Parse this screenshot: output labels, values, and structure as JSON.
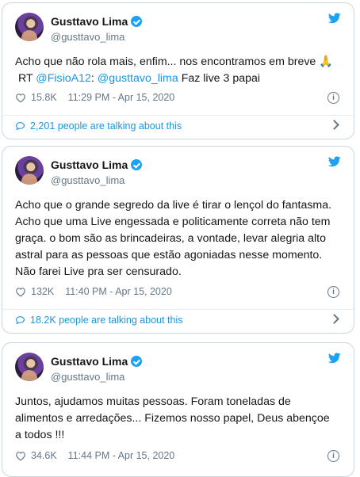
{
  "icons": {
    "verified": "verified-badge-icon",
    "twitter": "twitter-bird-icon",
    "like": "heart-icon",
    "info": "info-icon",
    "conversation": "speech-bubble-icon",
    "expand": "chevron-right-icon"
  },
  "colors": {
    "accent": "#1da1f2",
    "link": "#1b95e0",
    "muted": "#657786",
    "border": "#ccd6dd"
  },
  "tweets": [
    {
      "name": "Gusttavo Lima",
      "handle": "@gusttavo_lima",
      "text_part1": "Acho que não rola mais, enfim... nos encontramos em breve 🙏\n RT ",
      "mention1": "@FisioA12",
      "text_part2": ": ",
      "mention2": "@gusttavo_lima",
      "text_part3": " Faz live 3 papai",
      "likes": "15.8K",
      "timestamp": "11:29 PM - Apr 15, 2020",
      "talking": "2,201 people are talking about this"
    },
    {
      "name": "Gusttavo Lima",
      "handle": "@gusttavo_lima",
      "text": "Acho que o grande segredo da live é tirar o lençol do fantasma.\nAcho que uma Live engessada e politicamente correta não tem\ngraça. o bom são as brincadeiras, a vontade, levar alegria alto\nastral para as pessoas que estão agoniadas nesse momento.\nNão farei Live pra ser censurado.",
      "likes": "132K",
      "timestamp": "11:40 PM - Apr 15, 2020",
      "talking": "18.2K people are talking about this"
    },
    {
      "name": "Gusttavo Lima",
      "handle": "@gusttavo_lima",
      "text": "Juntos, ajudamos muitas pessoas. Foram toneladas de\nalimentos e arredações... Fizemos nosso papel, Deus abençoe\na todos !!!",
      "likes": "34.6K",
      "timestamp": "11:44 PM - Apr 15, 2020"
    }
  ]
}
